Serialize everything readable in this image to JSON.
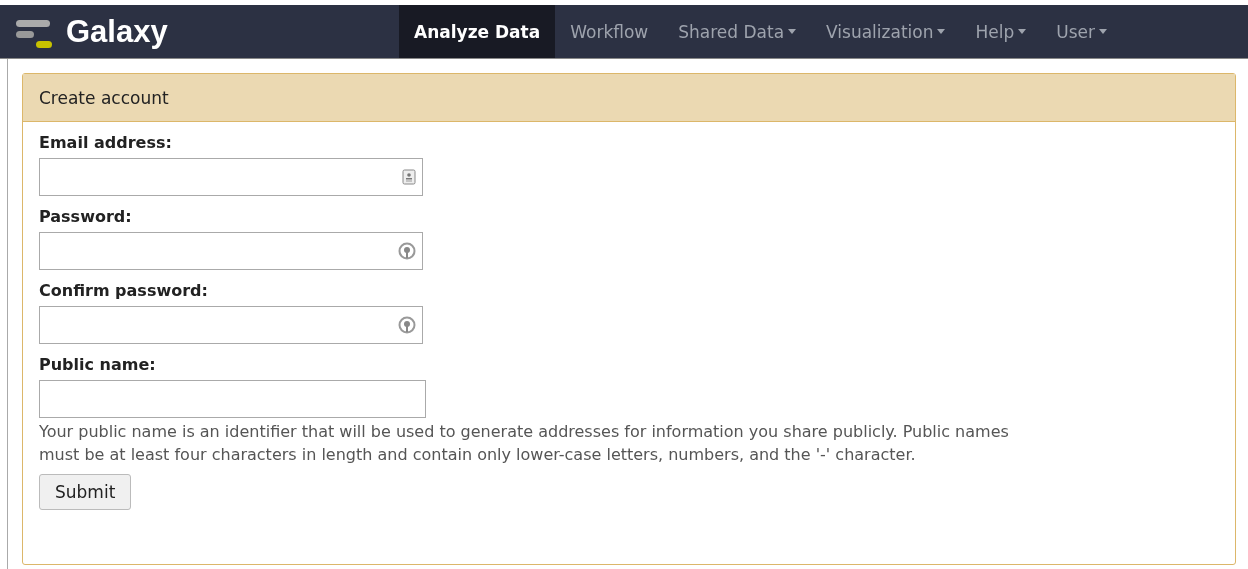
{
  "brand": {
    "title": "Galaxy"
  },
  "nav": [
    {
      "label": "Analyze Data",
      "selected": true,
      "dropdown": false
    },
    {
      "label": "Workflow",
      "selected": false,
      "dropdown": false
    },
    {
      "label": "Shared Data",
      "selected": false,
      "dropdown": true
    },
    {
      "label": "Visualization",
      "selected": false,
      "dropdown": true
    },
    {
      "label": "Help",
      "selected": false,
      "dropdown": true
    },
    {
      "label": "User",
      "selected": false,
      "dropdown": true
    }
  ],
  "form": {
    "title": "Create account",
    "fields": [
      {
        "label": "Email address:",
        "kind": "email"
      },
      {
        "label": "Password:",
        "kind": "password"
      },
      {
        "label": "Confirm password:",
        "kind": "password"
      },
      {
        "label": "Public name:",
        "kind": "text"
      }
    ],
    "help": "Your public name is an identifier that will be used to generate addresses for information you share publicly. Public names must be at least four characters in length and contain only lower-case letters, numbers, and the '-' character.",
    "submit": "Submit"
  }
}
